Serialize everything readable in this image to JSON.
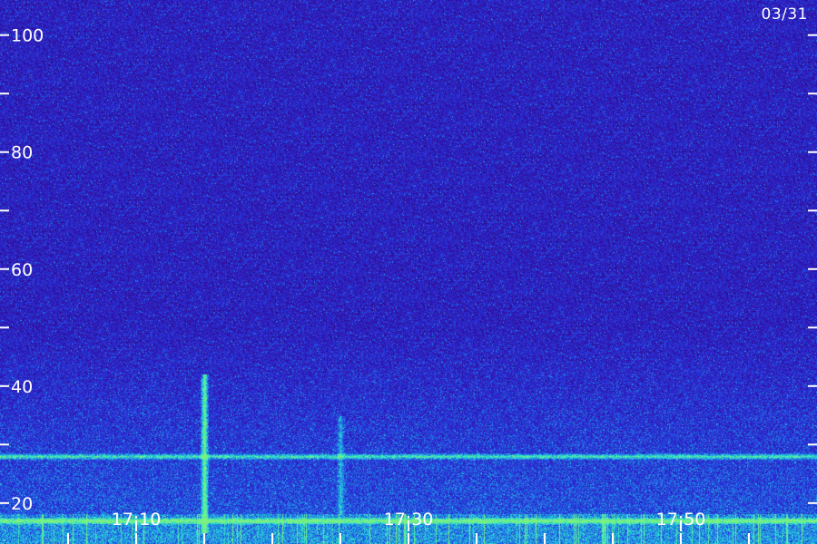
{
  "date": "03/31",
  "chart_data": {
    "type": "heatmap",
    "title": "",
    "xlabel": "",
    "ylabel": "",
    "ylim": [
      13,
      106
    ],
    "y_ticks_major": [
      20,
      40,
      60,
      80,
      100
    ],
    "y_ticks_minor": [
      30,
      50,
      70,
      90
    ],
    "x_tick_labels": [
      "17:10",
      "17:30",
      "17:50"
    ],
    "x_range": [
      "17:00",
      "18:00"
    ],
    "color_scale": [
      "#1a0850",
      "#3410a8",
      "#2636e0",
      "#1fa0e8",
      "#2ee8c8",
      "#7cf080"
    ],
    "features": [
      {
        "kind": "horizontal_band",
        "y": 28,
        "intensity": 0.6
      },
      {
        "kind": "horizontal_band",
        "y": 17,
        "intensity": 0.8
      },
      {
        "kind": "vertical_burst",
        "time": "17:15",
        "y_from": 15,
        "y_to": 42,
        "intensity": 0.8
      },
      {
        "kind": "vertical_burst",
        "time": "17:25",
        "y_from": 18,
        "y_to": 35,
        "intensity": 0.35
      }
    ]
  }
}
